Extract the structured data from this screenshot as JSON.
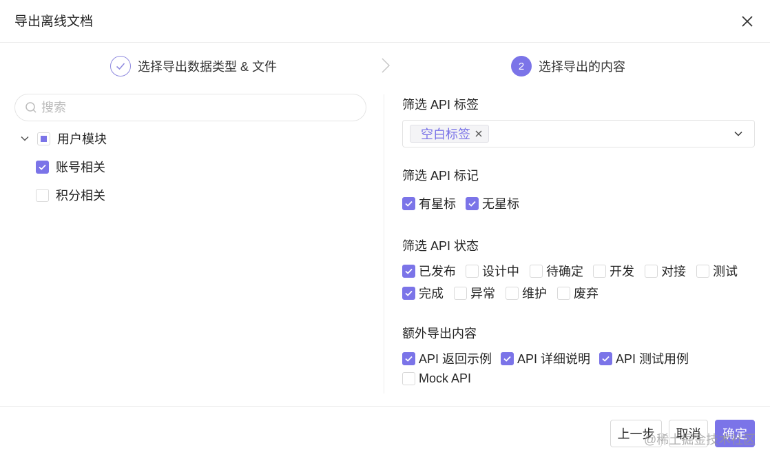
{
  "dialog": {
    "title": "导出离线文档"
  },
  "steps": [
    {
      "label": "选择导出数据类型 & 文件",
      "state": "done"
    },
    {
      "number": "2",
      "label": "选择导出的内容",
      "state": "current"
    }
  ],
  "left": {
    "search_placeholder": "搜索",
    "tree": {
      "parent": {
        "label": "用户模块",
        "state": "indeterminate"
      },
      "children": [
        {
          "label": "账号相关",
          "checked": true
        },
        {
          "label": "积分相关",
          "checked": false
        }
      ]
    }
  },
  "right": {
    "tags_section": {
      "label": "筛选 API 标签",
      "selected_tags": [
        "空白标签"
      ]
    },
    "marks_section": {
      "label": "筛选 API 标记",
      "options": [
        {
          "label": "有星标",
          "checked": true
        },
        {
          "label": "无星标",
          "checked": true
        }
      ]
    },
    "status_section": {
      "label": "筛选 API 状态",
      "options": [
        {
          "label": "已发布",
          "checked": true
        },
        {
          "label": "设计中",
          "checked": false
        },
        {
          "label": "待确定",
          "checked": false
        },
        {
          "label": "开发",
          "checked": false
        },
        {
          "label": "对接",
          "checked": false
        },
        {
          "label": "测试",
          "checked": false
        },
        {
          "label": "完成",
          "checked": true
        },
        {
          "label": "异常",
          "checked": false
        },
        {
          "label": "维护",
          "checked": false
        },
        {
          "label": "废弃",
          "checked": false
        }
      ]
    },
    "extra_section": {
      "label": "额外导出内容",
      "options": [
        {
          "label": "API 返回示例",
          "checked": true
        },
        {
          "label": "API 详细说明",
          "checked": true
        },
        {
          "label": "API 测试用例",
          "checked": true
        },
        {
          "label": "Mock API",
          "checked": false
        }
      ]
    }
  },
  "footer": {
    "prev_label": "上一步",
    "cancel_label": "取消",
    "confirm_label": "确定"
  },
  "watermark": {
    "text": "@稀土掘金技术社区"
  },
  "colors": {
    "accent": "#7b74e8",
    "border": "#d9d9d9",
    "divider": "#ececec"
  }
}
